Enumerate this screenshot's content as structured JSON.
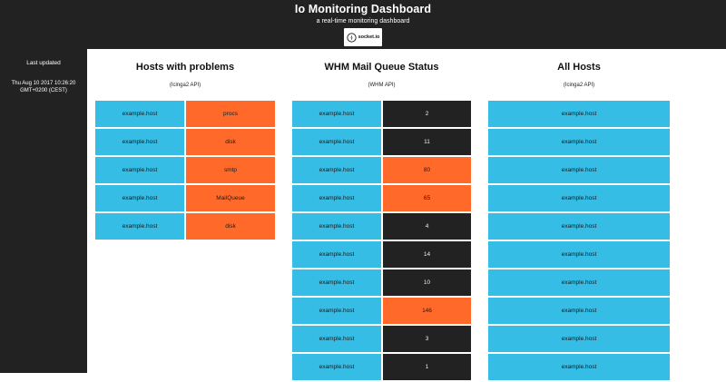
{
  "header": {
    "title": "Io Monitoring Dashboard",
    "subtitle": "a real-time monitoring dashboard",
    "logo_text": "socket.io"
  },
  "sidebar": {
    "label": "Last updated",
    "timestamp": "Thu Aug 10 2017 10:26:20 GMT+0200 (CEST)"
  },
  "panels": {
    "problems": {
      "title": "Hosts with problems",
      "subtitle": "(Icinga2 API)",
      "rows": [
        {
          "host": "example.host",
          "problem": "procs"
        },
        {
          "host": "example.host",
          "problem": "disk"
        },
        {
          "host": "example.host",
          "problem": "smtp"
        },
        {
          "host": "example.host",
          "problem": "MailQueue"
        },
        {
          "host": "example.host",
          "problem": "disk"
        }
      ]
    },
    "mailqueue": {
      "title": "WHM Mail Queue Status",
      "subtitle": "(WHM API)",
      "rows": [
        {
          "host": "example.host",
          "count": "2",
          "status": "ok"
        },
        {
          "host": "example.host",
          "count": "11",
          "status": "ok"
        },
        {
          "host": "example.host",
          "count": "80",
          "status": "warn"
        },
        {
          "host": "example.host",
          "count": "65",
          "status": "warn"
        },
        {
          "host": "example.host",
          "count": "4",
          "status": "ok"
        },
        {
          "host": "example.host",
          "count": "14",
          "status": "ok"
        },
        {
          "host": "example.host",
          "count": "10",
          "status": "ok"
        },
        {
          "host": "example.host",
          "count": "146",
          "status": "warn"
        },
        {
          "host": "example.host",
          "count": "3",
          "status": "ok"
        },
        {
          "host": "example.host",
          "count": "1",
          "status": "ok"
        }
      ]
    },
    "allhosts": {
      "title": "All Hosts",
      "subtitle": "(Icinga2 API)",
      "rows": [
        {
          "host": "example.host"
        },
        {
          "host": "example.host"
        },
        {
          "host": "example.host"
        },
        {
          "host": "example.host"
        },
        {
          "host": "example.host"
        },
        {
          "host": "example.host"
        },
        {
          "host": "example.host"
        },
        {
          "host": "example.host"
        },
        {
          "host": "example.host"
        },
        {
          "host": "example.host"
        }
      ]
    }
  },
  "colors": {
    "host": "#35bde6",
    "warn": "#ff6a2b",
    "ok": "#222222",
    "chrome": "#222222"
  }
}
